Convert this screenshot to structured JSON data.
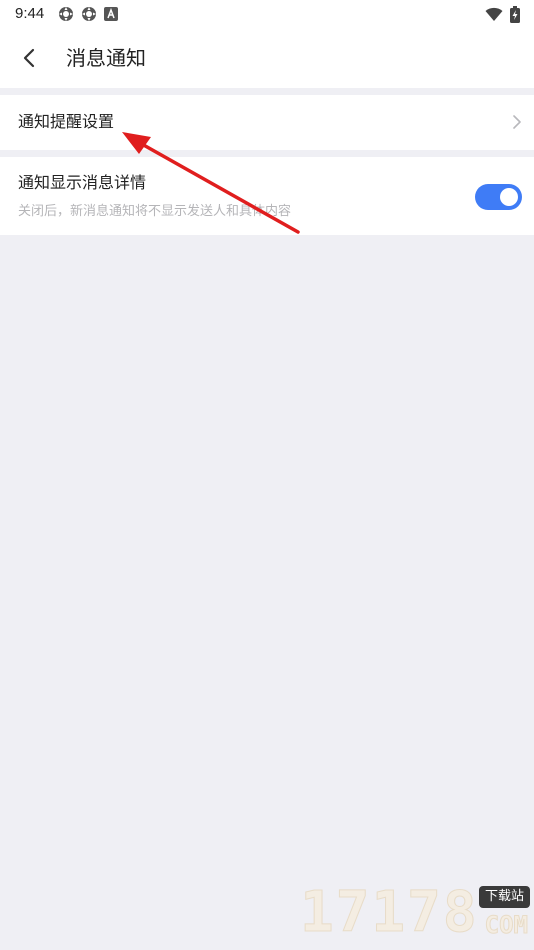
{
  "status_bar": {
    "time": "9:44",
    "left_icons": [
      "settings-gear-icon",
      "settings-gear-icon",
      "accessibility-a-icon"
    ],
    "right_icons": [
      "wifi-icon",
      "battery-charging-icon"
    ]
  },
  "header": {
    "back_icon": "chevron-left-icon",
    "title": "消息通知"
  },
  "settings": [
    {
      "label": "通知提醒设置",
      "trailing_icon": "chevron-right-icon"
    },
    {
      "label": "通知显示消息详情",
      "description": "关闭后，新消息通知将不显示发送人和具体内容",
      "toggle_on": true
    }
  ],
  "watermark": {
    "digits": "17178",
    "badge": "下载站",
    "suffix": "COM"
  },
  "colors": {
    "background": "#efeff4",
    "accent": "#3f7cf6",
    "annotation_arrow": "#e01e1e"
  }
}
